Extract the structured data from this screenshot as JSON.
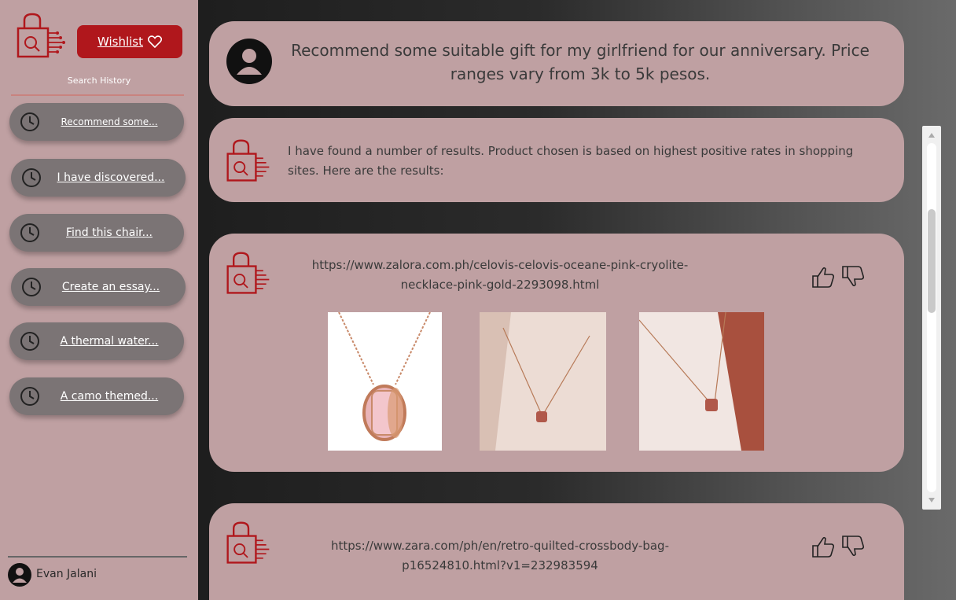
{
  "sidebar": {
    "wishlist_label": "Wishlist",
    "history_title": "Search History",
    "history": [
      {
        "label": "Recommend some..."
      },
      {
        "label": "I have discovered..."
      },
      {
        "label": "Find this chair..."
      },
      {
        "label": "Create an essay..."
      },
      {
        "label": "A thermal water..."
      },
      {
        "label": "A camo themed..."
      }
    ],
    "user_name": "Evan Jalani"
  },
  "chat": {
    "user_message": "Recommend some suitable gift for my girlfriend for our anniversary.  Price ranges vary from 3k to 5k pesos.",
    "bot_message": "I have found a number of results. Product chosen is based on highest positive rates in shopping sites. Here are the results:",
    "results": [
      {
        "link": "https://www.zalora.com.ph/celovis-celovis-oceane-pink-cryolite-necklace-pink-gold-2293098.html"
      },
      {
        "link": "https://www.zara.com/ph/en/retro-quilted-crossbody-bag-p16524810.html?v1=232983594"
      }
    ]
  },
  "colors": {
    "sidebar_bg": "#bfa0a2",
    "accent": "#b0171c",
    "history_item_bg": "#7b7475",
    "card_bg": "#bfa0a2"
  },
  "icons": {
    "logo": "shopping-bag-circuit-icon",
    "wishlist": "heart-icon",
    "history": "clock-icon",
    "user": "user-avatar-icon",
    "like": "thumbs-up-icon",
    "dislike": "thumbs-down-icon"
  }
}
